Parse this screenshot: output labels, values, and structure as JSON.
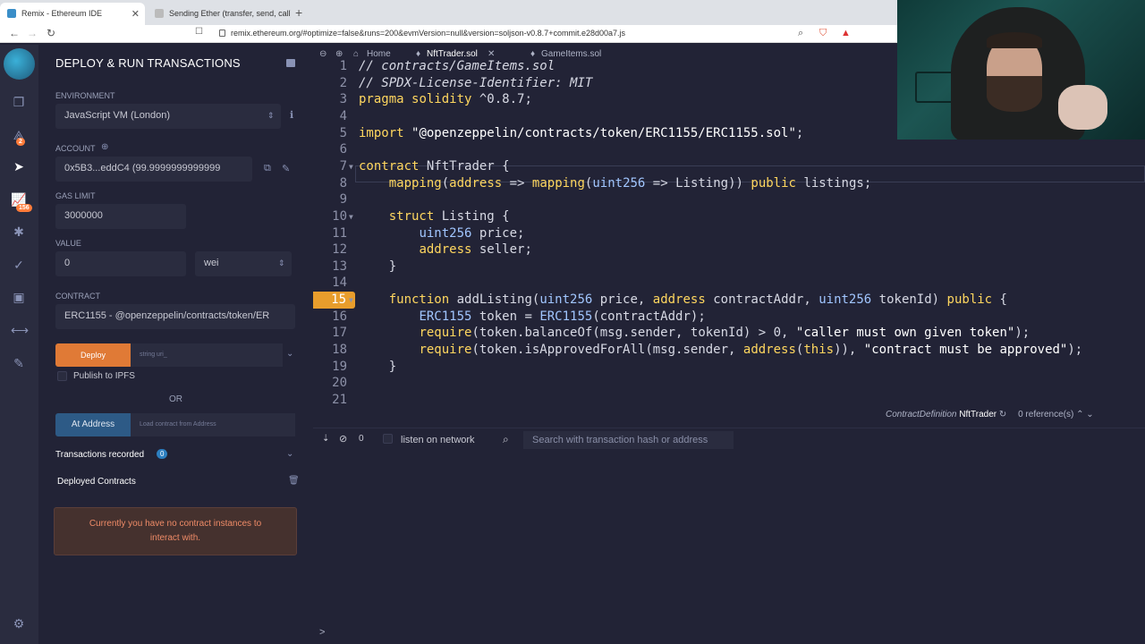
{
  "browser": {
    "tabs": [
      {
        "label": "Remix - Ethereum IDE",
        "active": true
      },
      {
        "label": "Sending Ether (transfer, send, call)",
        "active": false
      }
    ],
    "url": "remix.ethereum.org/#optimize=false&runs=200&evmVersion=null&version=soljson-v0.8.7+commit.e28d00a7.js"
  },
  "rail": {
    "badges": {
      "compiler": "2",
      "analysis": "156"
    }
  },
  "panel": {
    "title": "DEPLOY & RUN TRANSACTIONS",
    "environment_label": "ENVIRONMENT",
    "environment_value": "JavaScript VM (London)",
    "account_label": "ACCOUNT",
    "account_value": "0x5B3...eddC4 (99.9999999999999",
    "gas_label": "GAS LIMIT",
    "gas_value": "3000000",
    "value_label": "VALUE",
    "value_amount": "0",
    "value_unit": "wei",
    "contract_label": "CONTRACT",
    "contract_value": "ERC1155 - @openzeppelin/contracts/token/ER",
    "deploy_label": "Deploy",
    "deploy_placeholder": "string uri_",
    "publish_label": "Publish to IPFS",
    "or_label": "OR",
    "at_address_label": "At Address",
    "at_address_placeholder": "Load contract from Address",
    "tx_recorded_label": "Transactions recorded",
    "tx_recorded_count": "0",
    "deployed_label": "Deployed Contracts",
    "warning": "Currently you have no contract instances to interact with."
  },
  "editor": {
    "tabs": [
      {
        "label": "Home",
        "active": false
      },
      {
        "label": "NftTrader.sol",
        "active": true
      },
      {
        "label": "GameItems.sol",
        "active": false
      }
    ],
    "lines": [
      {
        "n": "1",
        "text": "// contracts/GameItems.sol"
      },
      {
        "n": "2",
        "text": "// SPDX-License-Identifier: MIT"
      },
      {
        "n": "3",
        "text": "pragma solidity ^0.8.7;"
      },
      {
        "n": "4",
        "text": ""
      },
      {
        "n": "5",
        "text": "import \"@openzeppelin/contracts/token/ERC1155/ERC1155.sol\";"
      },
      {
        "n": "6",
        "text": ""
      },
      {
        "n": "7",
        "text": "contract NftTrader {"
      },
      {
        "n": "8",
        "text": "    mapping(address => mapping(uint256 => Listing)) public listings;"
      },
      {
        "n": "9",
        "text": ""
      },
      {
        "n": "10",
        "text": "    struct Listing {"
      },
      {
        "n": "11",
        "text": "        uint256 price;"
      },
      {
        "n": "12",
        "text": "        address seller;"
      },
      {
        "n": "13",
        "text": "    }"
      },
      {
        "n": "14",
        "text": ""
      },
      {
        "n": "15",
        "text": "    function addListing(uint256 price, address contractAddr, uint256 tokenId) public {"
      },
      {
        "n": "16",
        "text": "        ERC1155 token = ERC1155(contractAddr);"
      },
      {
        "n": "17",
        "text": "        require(token.balanceOf(msg.sender, tokenId) > 0, \"caller must own given token\");"
      },
      {
        "n": "18",
        "text": "        require(token.isApprovedForAll(msg.sender, address(this)), \"contract must be approved\");"
      },
      {
        "n": "19",
        "text": "    }"
      },
      {
        "n": "20",
        "text": ""
      },
      {
        "n": "21",
        "text": ""
      }
    ],
    "status_definition": "ContractDefinition",
    "status_name": "NftTrader",
    "status_refs": "0 reference(s)"
  },
  "terminal": {
    "count": "0",
    "listen_label": "listen on network",
    "search_placeholder": "Search with transaction hash or address",
    "prompt": ">"
  },
  "colors": {
    "accent_deploy": "#e07a36",
    "accent_at_address": "#2d5a86",
    "breakpoint": "#e89d2c",
    "warning_text": "#ef8b67"
  }
}
